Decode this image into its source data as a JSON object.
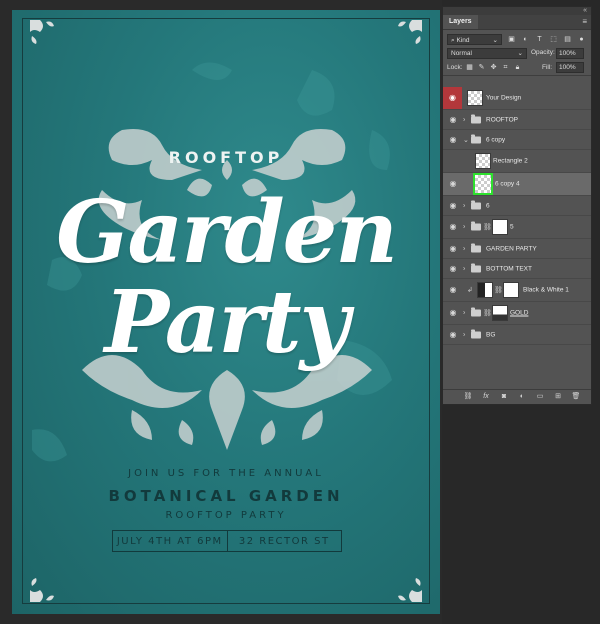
{
  "poster": {
    "rooftop": "ROOFTOP",
    "title_line1": "Garden",
    "title_line2": "Party",
    "join": "JOIN US FOR THE ANNUAL",
    "event": "BOTANICAL GARDEN",
    "subevent": "ROOFTOP PARTY",
    "date": "JULY 4TH AT 6PM",
    "address": "32 RECTOR ST"
  },
  "panel": {
    "tab": "Layers",
    "filter_kind": "Kind",
    "blend_mode": "Normal",
    "opacity_label": "Opacity:",
    "opacity_value": "100%",
    "lock_label": "Lock:",
    "fill_label": "Fill:",
    "fill_value": "100%",
    "layers": [
      {
        "name": "Your Design"
      },
      {
        "name": "ROOFTOP"
      },
      {
        "name": "6 copy"
      },
      {
        "name": "Rectangle 2"
      },
      {
        "name": "6 copy 4"
      },
      {
        "name": "6"
      },
      {
        "name": "5"
      },
      {
        "name": "GARDEN PARTY"
      },
      {
        "name": "BOTTOM TEXT"
      },
      {
        "name": "Black & White 1"
      },
      {
        "name": "GOLD"
      },
      {
        "name": "BG"
      }
    ]
  },
  "colors": {
    "poster_teal": "#24777a",
    "ink": "#123a3c",
    "panel_bg": "#535353",
    "selected_row": "#6a6a6a",
    "eye_highlight": "#b3373b",
    "focus_green": "#2ee02e"
  },
  "icons": {
    "visibility": "eye-icon",
    "group": "folder-icon",
    "link": "link-icon",
    "expand": "chevron-right-icon",
    "collapse": "chevron-down-icon"
  }
}
